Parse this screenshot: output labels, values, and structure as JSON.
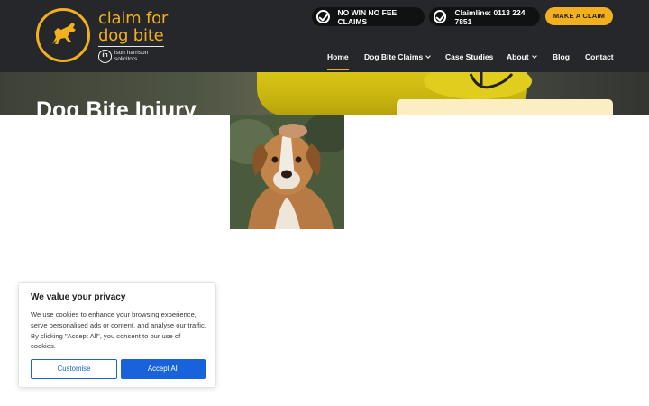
{
  "brand": {
    "logo_line1": "claim for",
    "logo_line2": "dog bite",
    "sub_brand_line1": "ison harrison",
    "sub_brand_line2": "solicitors",
    "sub_brand_mark": "ih",
    "accent_color": "#f2b01e",
    "header_bg": "#25272a"
  },
  "header": {
    "no_win_label": "NO WIN NO FEE CLAIMS",
    "claimline_label": "Claimline: 0113 224 7851",
    "make_claim_label": "MAKE A CLAIM"
  },
  "nav": {
    "items": [
      {
        "label": "Home",
        "active": true
      },
      {
        "label": "Dog Bite Claims",
        "has_dropdown": true
      },
      {
        "label": "Case Studies"
      },
      {
        "label": "About",
        "has_dropdown": true
      },
      {
        "label": "Blog"
      },
      {
        "label": "Contact"
      }
    ]
  },
  "hero": {
    "title": "Dog Bite Injury"
  },
  "cookie": {
    "title": "We value your privacy",
    "text": "We use cookies to enhance your browsing experience, serve personalised ads or content, and analyse our traffic. By clicking \"Accept All\", you consent to our use of cookies.",
    "customise_label": "Customise",
    "accept_label": "Accept All",
    "button_color": "#1863dc"
  }
}
